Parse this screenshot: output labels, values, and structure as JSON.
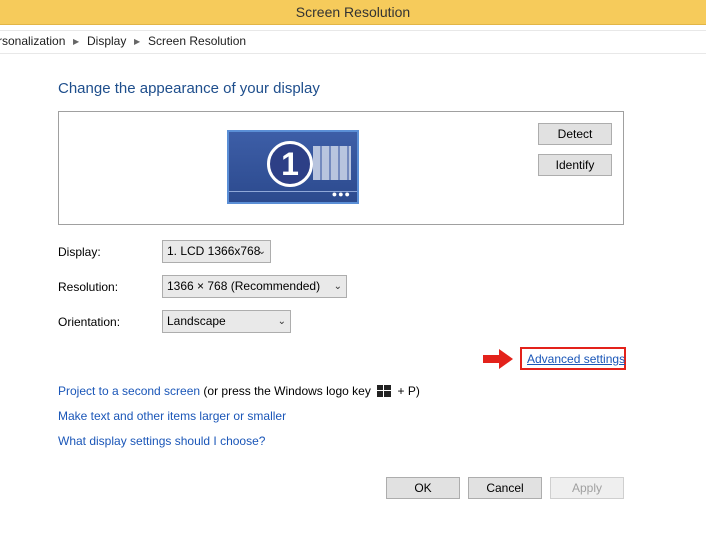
{
  "window": {
    "title": "Screen Resolution"
  },
  "breadcrumb": {
    "items": [
      "rsonalization",
      "Display",
      "Screen Resolution"
    ]
  },
  "heading": "Change the appearance of your display",
  "monitor": {
    "number": "1"
  },
  "panel_buttons": {
    "detect": "Detect",
    "identify": "Identify"
  },
  "fields": {
    "display": {
      "label": "Display:",
      "value": "1. LCD 1366x768"
    },
    "resolution": {
      "label": "Resolution:",
      "value": "1366 × 768 (Recommended)"
    },
    "orientation": {
      "label": "Orientation:",
      "value": "Landscape"
    }
  },
  "advanced_link": "Advanced settings",
  "links": {
    "project": "Project to a second screen",
    "project_suffix_pre": "(or press the Windows logo key",
    "project_suffix_post": "+ P)",
    "larger_text": "Make text and other items larger or smaller",
    "which_settings": "What display settings should I choose?"
  },
  "footer_buttons": {
    "ok": "OK",
    "cancel": "Cancel",
    "apply": "Apply"
  },
  "colors": {
    "titlebar": "#f6cb5b",
    "link": "#1a56b8",
    "highlight": "#e3221b"
  }
}
